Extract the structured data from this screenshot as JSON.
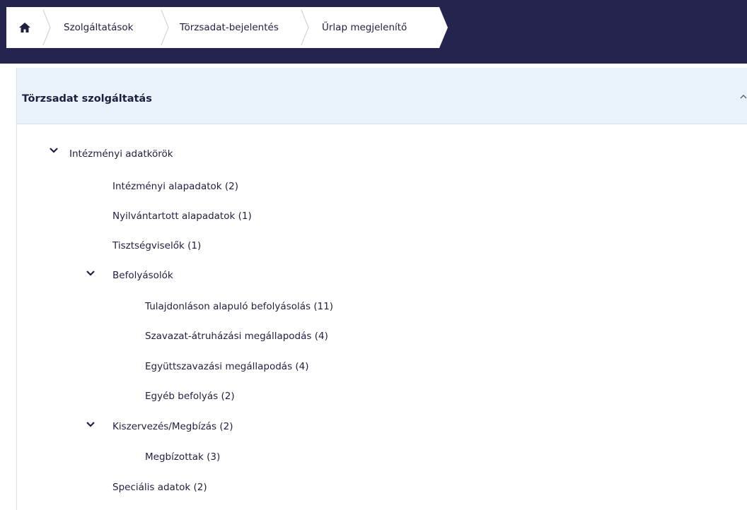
{
  "breadcrumb": {
    "home_icon": "home-icon",
    "items": [
      {
        "label": "Szolgáltatások"
      },
      {
        "label": "Törzsadat-bejelentés"
      },
      {
        "label": "Űrlap megjelenítő"
      }
    ]
  },
  "panel": {
    "title": "Törzsadat szolgáltatás",
    "collapse_icon": "chevron-up-icon"
  },
  "tree": {
    "root": {
      "label": "Intézményi adatkörök",
      "expanded": true
    },
    "items": [
      {
        "label": "Intézményi alapadatok (2)"
      },
      {
        "label": "Nyilvántartott alapadatok (1)"
      },
      {
        "label": "Tisztségviselők  (1)"
      },
      {
        "label": "Befolyásolók",
        "expanded": true
      },
      {
        "label": "Tulajdonláson alapuló befolyásolás (11)"
      },
      {
        "label": "Szavazat-átruházási megállapodás (4)"
      },
      {
        "label": "Együttszavazási megállapodás (4)"
      },
      {
        "label": "Egyéb befolyás (2)"
      },
      {
        "label": "Kiszervezés/Megbízás (2)",
        "expanded": true
      },
      {
        "label": "Megbízottak (3)"
      },
      {
        "label": "Speciális adatok (2)"
      }
    ]
  },
  "colors": {
    "topbar": "#24244f",
    "panel_header": "#e8f2f8",
    "text": "#1f2040"
  }
}
